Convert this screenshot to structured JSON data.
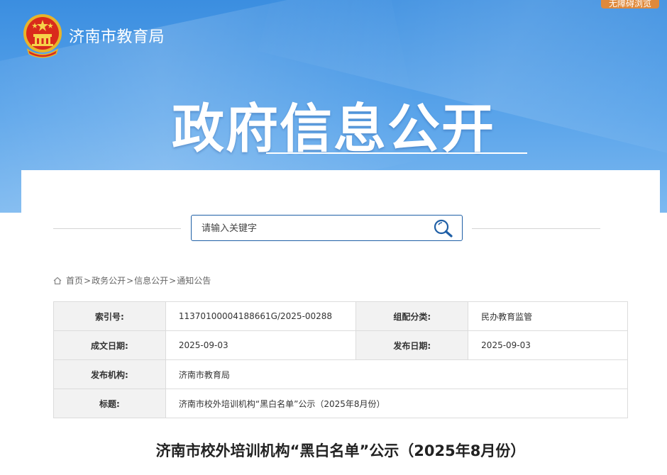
{
  "header": {
    "accessibility_label": "无障碍浏览",
    "site_name": "济南市教育局",
    "hero_title": "政府信息公开"
  },
  "search": {
    "placeholder": "请输入关键字"
  },
  "breadcrumb": {
    "items": [
      "首页",
      "政务公开",
      "信息公开",
      "通知公告"
    ],
    "separator": ">"
  },
  "meta_table": {
    "index_label": "索引号:",
    "index_value": "11370100004188661G/2025-00288",
    "category_label": "组配分类:",
    "category_value": "民办教育监管",
    "created_label": "成文日期:",
    "created_value": "2025-09-03",
    "published_label": "发布日期:",
    "published_value": "2025-09-03",
    "publisher_label": "发布机构:",
    "publisher_value": "济南市教育局",
    "title_label": "标题:",
    "title_value": "济南市校外培训机构“黑白名单”公示（2025年8月份）"
  },
  "document": {
    "title": "济南市校外培训机构“黑白名单”公示（2025年8月份）"
  },
  "colors": {
    "banner_blue": "#3b8ee0",
    "accent_orange": "#e0893a",
    "search_border": "#1f5fa6"
  }
}
